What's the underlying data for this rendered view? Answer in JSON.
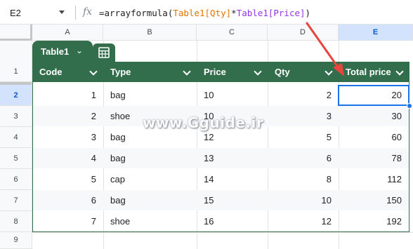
{
  "formula_bar": {
    "cell_ref": "E2",
    "fx_label": "fx",
    "formula_prefix": "=arrayformula(",
    "formula_ref1": "Table1[Qty]",
    "formula_op": "*",
    "formula_ref2": "Table1[Price]",
    "formula_suffix": ")"
  },
  "columns": [
    "A",
    "B",
    "C",
    "D",
    "E"
  ],
  "selected_column": "E",
  "rows": [
    "1",
    "2",
    "3",
    "4",
    "5",
    "6",
    "7",
    "8",
    "9"
  ],
  "selected_row": "2",
  "table": {
    "name": "Table1",
    "headers": [
      "Code",
      "Type",
      "Price",
      "Qty",
      "Total price"
    ],
    "rows": [
      {
        "code": "1",
        "type": "bag",
        "price": "10",
        "qty": "2",
        "total": "20"
      },
      {
        "code": "2",
        "type": "shoe",
        "price": "10",
        "qty": "3",
        "total": "30"
      },
      {
        "code": "3",
        "type": "bag",
        "price": "12",
        "qty": "5",
        "total": "60"
      },
      {
        "code": "4",
        "type": "bag",
        "price": "13",
        "qty": "6",
        "total": "78"
      },
      {
        "code": "5",
        "type": "cap",
        "price": "14",
        "qty": "8",
        "total": "112"
      },
      {
        "code": "6",
        "type": "bag",
        "price": "15",
        "qty": "10",
        "total": "150"
      },
      {
        "code": "7",
        "type": "shoe",
        "price": "16",
        "qty": "12",
        "total": "192"
      }
    ]
  },
  "watermark": "www.Gguide.ir",
  "colors": {
    "table_green": "#336e4c",
    "selection_blue": "#1a73e8",
    "annotation_red": "#e8453c"
  },
  "icons": {
    "table_menu": "chevron-down-icon",
    "table_view": "grid-table-icon",
    "column_menu": "chevron-down-icon"
  }
}
